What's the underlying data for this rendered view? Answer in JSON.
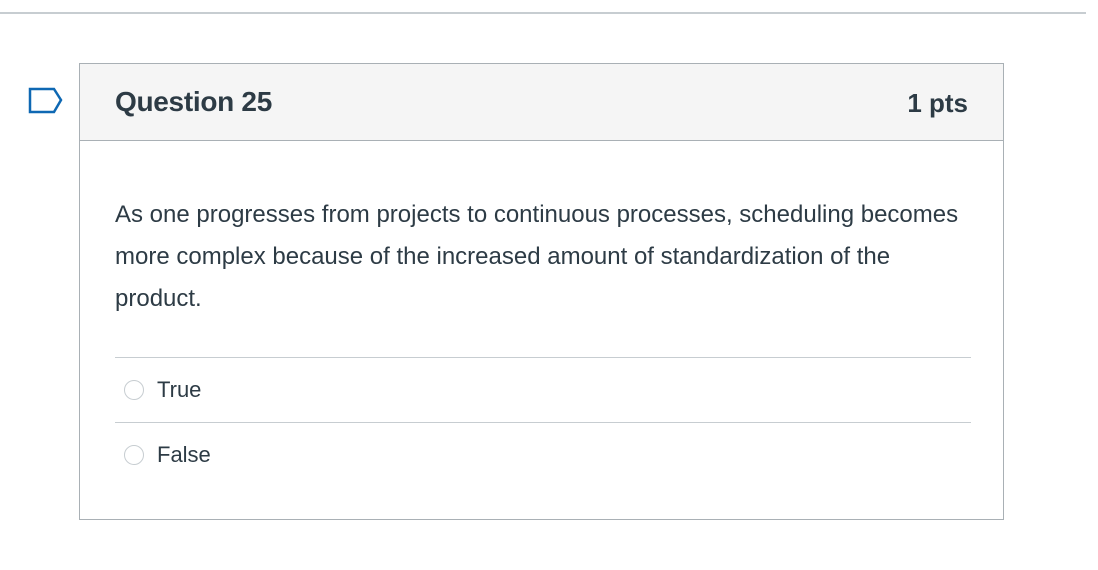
{
  "question": {
    "title": "Question 25",
    "points": "1 pts",
    "text": "As one progresses from projects to continuous processes, scheduling becomes more complex because of the increased amount of standardization of the product.",
    "flag_icon": "flag-question-icon",
    "answers": [
      {
        "label": "True",
        "selected": false
      },
      {
        "label": "False",
        "selected": false
      }
    ]
  },
  "colors": {
    "header_bg": "#f5f5f5",
    "border": "#a9b0b5",
    "text": "#2d3b45",
    "flag": "#0e68b3"
  }
}
